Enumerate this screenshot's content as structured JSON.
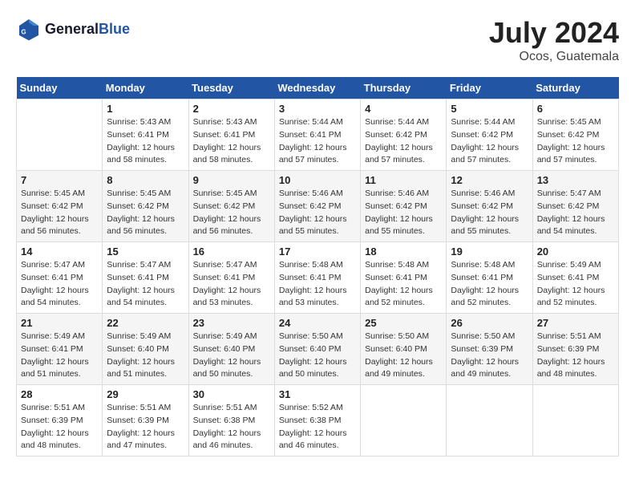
{
  "header": {
    "logo_line1": "General",
    "logo_line2": "Blue",
    "title": "July 2024",
    "subtitle": "Ocos, Guatemala"
  },
  "columns": [
    "Sunday",
    "Monday",
    "Tuesday",
    "Wednesday",
    "Thursday",
    "Friday",
    "Saturday"
  ],
  "weeks": [
    [
      {
        "day": "",
        "detail": ""
      },
      {
        "day": "1",
        "detail": "Sunrise: 5:43 AM\nSunset: 6:41 PM\nDaylight: 12 hours\nand 58 minutes."
      },
      {
        "day": "2",
        "detail": "Sunrise: 5:43 AM\nSunset: 6:41 PM\nDaylight: 12 hours\nand 58 minutes."
      },
      {
        "day": "3",
        "detail": "Sunrise: 5:44 AM\nSunset: 6:41 PM\nDaylight: 12 hours\nand 57 minutes."
      },
      {
        "day": "4",
        "detail": "Sunrise: 5:44 AM\nSunset: 6:42 PM\nDaylight: 12 hours\nand 57 minutes."
      },
      {
        "day": "5",
        "detail": "Sunrise: 5:44 AM\nSunset: 6:42 PM\nDaylight: 12 hours\nand 57 minutes."
      },
      {
        "day": "6",
        "detail": "Sunrise: 5:45 AM\nSunset: 6:42 PM\nDaylight: 12 hours\nand 57 minutes."
      }
    ],
    [
      {
        "day": "7",
        "detail": "Sunrise: 5:45 AM\nSunset: 6:42 PM\nDaylight: 12 hours\nand 56 minutes."
      },
      {
        "day": "8",
        "detail": "Sunrise: 5:45 AM\nSunset: 6:42 PM\nDaylight: 12 hours\nand 56 minutes."
      },
      {
        "day": "9",
        "detail": "Sunrise: 5:45 AM\nSunset: 6:42 PM\nDaylight: 12 hours\nand 56 minutes."
      },
      {
        "day": "10",
        "detail": "Sunrise: 5:46 AM\nSunset: 6:42 PM\nDaylight: 12 hours\nand 55 minutes."
      },
      {
        "day": "11",
        "detail": "Sunrise: 5:46 AM\nSunset: 6:42 PM\nDaylight: 12 hours\nand 55 minutes."
      },
      {
        "day": "12",
        "detail": "Sunrise: 5:46 AM\nSunset: 6:42 PM\nDaylight: 12 hours\nand 55 minutes."
      },
      {
        "day": "13",
        "detail": "Sunrise: 5:47 AM\nSunset: 6:42 PM\nDaylight: 12 hours\nand 54 minutes."
      }
    ],
    [
      {
        "day": "14",
        "detail": "Sunrise: 5:47 AM\nSunset: 6:41 PM\nDaylight: 12 hours\nand 54 minutes."
      },
      {
        "day": "15",
        "detail": "Sunrise: 5:47 AM\nSunset: 6:41 PM\nDaylight: 12 hours\nand 54 minutes."
      },
      {
        "day": "16",
        "detail": "Sunrise: 5:47 AM\nSunset: 6:41 PM\nDaylight: 12 hours\nand 53 minutes."
      },
      {
        "day": "17",
        "detail": "Sunrise: 5:48 AM\nSunset: 6:41 PM\nDaylight: 12 hours\nand 53 minutes."
      },
      {
        "day": "18",
        "detail": "Sunrise: 5:48 AM\nSunset: 6:41 PM\nDaylight: 12 hours\nand 52 minutes."
      },
      {
        "day": "19",
        "detail": "Sunrise: 5:48 AM\nSunset: 6:41 PM\nDaylight: 12 hours\nand 52 minutes."
      },
      {
        "day": "20",
        "detail": "Sunrise: 5:49 AM\nSunset: 6:41 PM\nDaylight: 12 hours\nand 52 minutes."
      }
    ],
    [
      {
        "day": "21",
        "detail": "Sunrise: 5:49 AM\nSunset: 6:41 PM\nDaylight: 12 hours\nand 51 minutes."
      },
      {
        "day": "22",
        "detail": "Sunrise: 5:49 AM\nSunset: 6:40 PM\nDaylight: 12 hours\nand 51 minutes."
      },
      {
        "day": "23",
        "detail": "Sunrise: 5:49 AM\nSunset: 6:40 PM\nDaylight: 12 hours\nand 50 minutes."
      },
      {
        "day": "24",
        "detail": "Sunrise: 5:50 AM\nSunset: 6:40 PM\nDaylight: 12 hours\nand 50 minutes."
      },
      {
        "day": "25",
        "detail": "Sunrise: 5:50 AM\nSunset: 6:40 PM\nDaylight: 12 hours\nand 49 minutes."
      },
      {
        "day": "26",
        "detail": "Sunrise: 5:50 AM\nSunset: 6:39 PM\nDaylight: 12 hours\nand 49 minutes."
      },
      {
        "day": "27",
        "detail": "Sunrise: 5:51 AM\nSunset: 6:39 PM\nDaylight: 12 hours\nand 48 minutes."
      }
    ],
    [
      {
        "day": "28",
        "detail": "Sunrise: 5:51 AM\nSunset: 6:39 PM\nDaylight: 12 hours\nand 48 minutes."
      },
      {
        "day": "29",
        "detail": "Sunrise: 5:51 AM\nSunset: 6:39 PM\nDaylight: 12 hours\nand 47 minutes."
      },
      {
        "day": "30",
        "detail": "Sunrise: 5:51 AM\nSunset: 6:38 PM\nDaylight: 12 hours\nand 46 minutes."
      },
      {
        "day": "31",
        "detail": "Sunrise: 5:52 AM\nSunset: 6:38 PM\nDaylight: 12 hours\nand 46 minutes."
      },
      {
        "day": "",
        "detail": ""
      },
      {
        "day": "",
        "detail": ""
      },
      {
        "day": "",
        "detail": ""
      }
    ]
  ]
}
